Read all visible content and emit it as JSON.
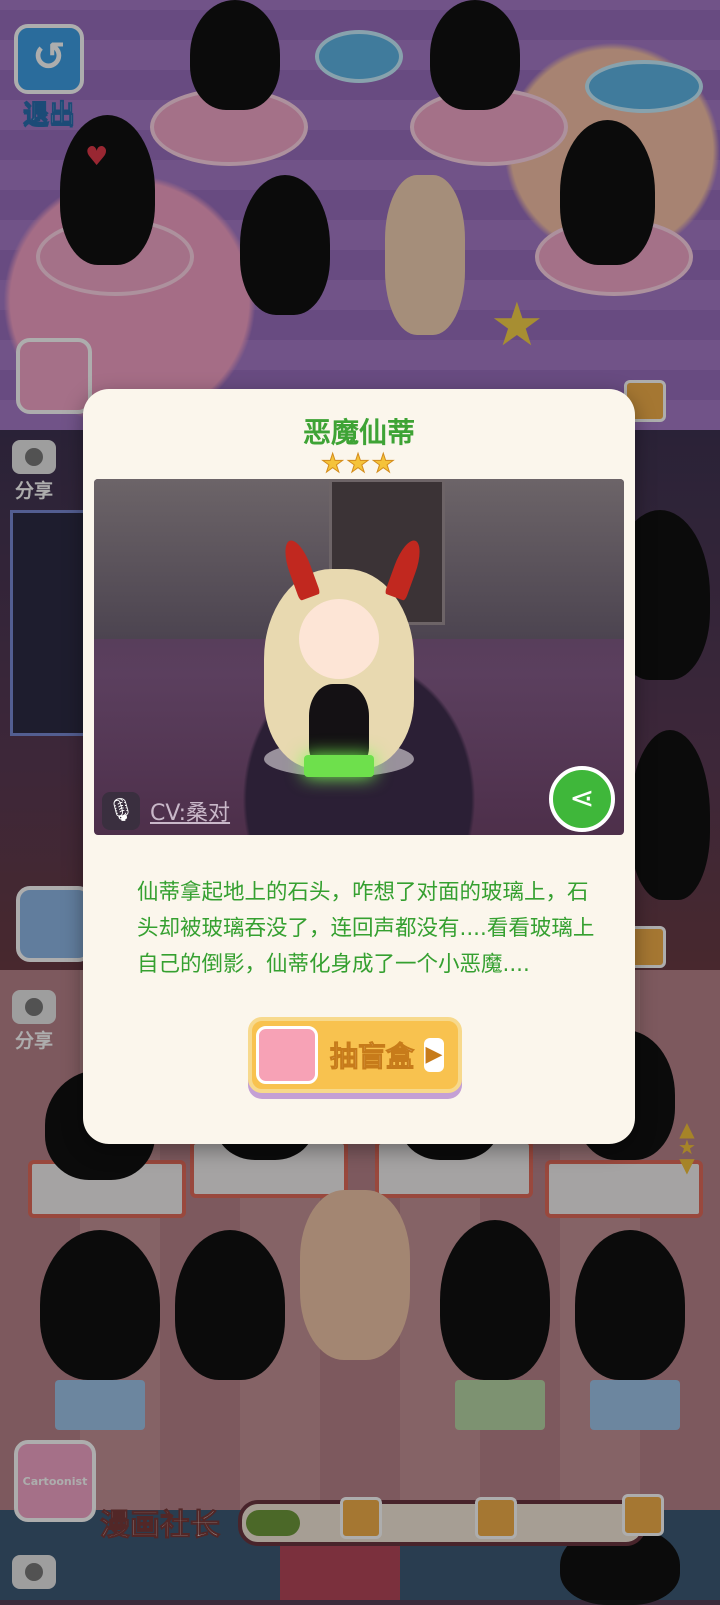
{
  "top_bar": {
    "exit_label": "退出"
  },
  "side_buttons": {
    "share_label_1": "分享",
    "share_label_2": "分享"
  },
  "collections": {
    "bottom_collection_name": "漫画社长",
    "bottom_badge_text": "Cartoonist"
  },
  "modal": {
    "title": "恶魔仙蒂",
    "stars": "★★★",
    "cv_label": "CV:桑对",
    "description": "仙蒂拿起地上的石头，咋想了对面的玻璃上，石头却被玻璃吞没了，连回声都没有....看看玻璃上自己的倒影，仙蒂化身成了一个小恶魔....",
    "gacha_button_label": "抽盲盒"
  },
  "icons": {
    "exit": "back-arrow-icon",
    "share": "camera-icon",
    "mic": "microphone-icon",
    "share_social": "share-icon",
    "gift": "gift-icon",
    "machine": "gacha-machine-icon"
  }
}
